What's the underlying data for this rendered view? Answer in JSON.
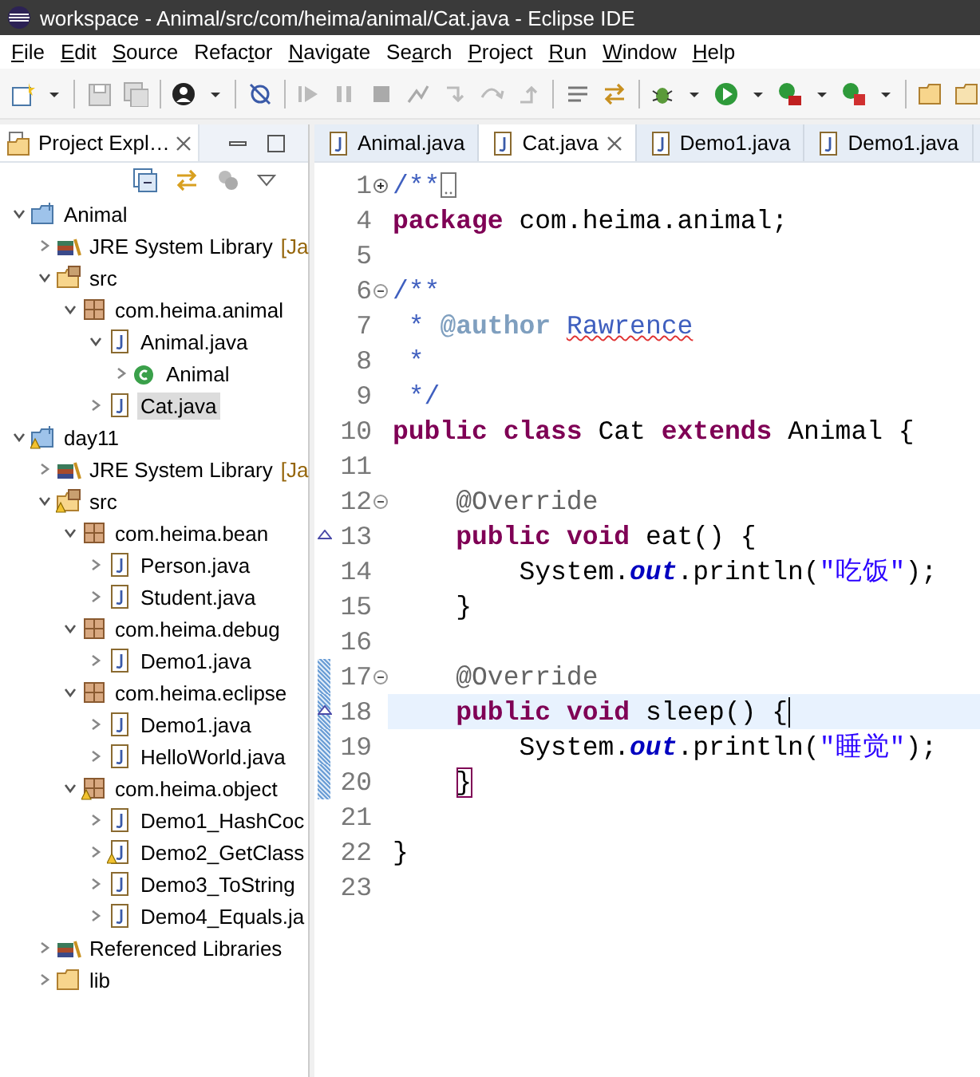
{
  "window": {
    "title": "workspace - Animal/src/com/heima/animal/Cat.java - Eclipse IDE"
  },
  "menu": [
    {
      "key": "F",
      "post": "ile"
    },
    {
      "key": "E",
      "post": "dit"
    },
    {
      "key": "S",
      "post": "ource"
    },
    {
      "pre": "Refac",
      "key": "t",
      "post": "or"
    },
    {
      "key": "N",
      "post": "avigate"
    },
    {
      "pre": "Se",
      "key": "a",
      "post": "rch"
    },
    {
      "key": "P",
      "post": "roject"
    },
    {
      "key": "R",
      "post": "un"
    },
    {
      "key": "W",
      "post": "indow"
    },
    {
      "key": "H",
      "post": "elp"
    }
  ],
  "explorer": {
    "title": "Project Expl…",
    "tree": [
      {
        "label": "Animal",
        "kind": "project",
        "expanded": true,
        "selected": false,
        "warning": false,
        "children": [
          {
            "label": "JRE System Library",
            "decoration": "[Ja",
            "kind": "library",
            "expanded": false,
            "selected": false,
            "warning": false
          },
          {
            "label": "src",
            "kind": "source-folder",
            "expanded": true,
            "selected": false,
            "warning": false,
            "children": [
              {
                "label": "com.heima.animal",
                "kind": "package",
                "expanded": true,
                "selected": false,
                "warning": false,
                "children": [
                  {
                    "label": "Animal.java",
                    "kind": "java-file",
                    "expanded": true,
                    "selected": false,
                    "warning": false,
                    "children": [
                      {
                        "label": "Animal",
                        "kind": "class",
                        "expanded": false,
                        "selected": false,
                        "warning": false
                      }
                    ]
                  },
                  {
                    "label": "Cat.java",
                    "kind": "java-file",
                    "expanded": false,
                    "selected": true,
                    "warning": false
                  }
                ]
              }
            ]
          }
        ]
      },
      {
        "label": "day11",
        "kind": "project",
        "expanded": true,
        "selected": false,
        "warning": true,
        "children": [
          {
            "label": "JRE System Library",
            "decoration": "[Ja",
            "kind": "library",
            "expanded": false,
            "selected": false,
            "warning": false
          },
          {
            "label": "src",
            "kind": "source-folder",
            "expanded": true,
            "selected": false,
            "warning": true,
            "children": [
              {
                "label": "com.heima.bean",
                "kind": "package",
                "expanded": true,
                "selected": false,
                "warning": false,
                "children": [
                  {
                    "label": "Person.java",
                    "kind": "java-file",
                    "expanded": false,
                    "selected": false,
                    "warning": false
                  },
                  {
                    "label": "Student.java",
                    "kind": "java-file",
                    "expanded": false,
                    "selected": false,
                    "warning": false
                  }
                ]
              },
              {
                "label": "com.heima.debug",
                "kind": "package",
                "expanded": true,
                "selected": false,
                "warning": false,
                "children": [
                  {
                    "label": "Demo1.java",
                    "kind": "java-file",
                    "expanded": false,
                    "selected": false,
                    "warning": false
                  }
                ]
              },
              {
                "label": "com.heima.eclipse",
                "kind": "package",
                "expanded": true,
                "selected": false,
                "warning": false,
                "children": [
                  {
                    "label": "Demo1.java",
                    "kind": "java-file",
                    "expanded": false,
                    "selected": false,
                    "warning": false
                  },
                  {
                    "label": "HelloWorld.java",
                    "kind": "java-file",
                    "expanded": false,
                    "selected": false,
                    "warning": false
                  }
                ]
              },
              {
                "label": "com.heima.object",
                "kind": "package",
                "expanded": true,
                "selected": false,
                "warning": true,
                "children": [
                  {
                    "label": "Demo1_HashCoc",
                    "kind": "java-file",
                    "expanded": false,
                    "selected": false,
                    "warning": false
                  },
                  {
                    "label": "Demo2_GetClass",
                    "kind": "java-file",
                    "expanded": false,
                    "selected": false,
                    "warning": true
                  },
                  {
                    "label": "Demo3_ToString",
                    "kind": "java-file",
                    "expanded": false,
                    "selected": false,
                    "warning": false
                  },
                  {
                    "label": "Demo4_Equals.ja",
                    "kind": "java-file",
                    "expanded": false,
                    "selected": false,
                    "warning": false
                  }
                ]
              }
            ]
          },
          {
            "label": "Referenced Libraries",
            "kind": "library",
            "expanded": false,
            "selected": false,
            "warning": false
          },
          {
            "label": "lib",
            "kind": "folder",
            "expanded": false,
            "selected": false,
            "warning": false
          }
        ]
      }
    ]
  },
  "tabs": [
    {
      "label": "Animal.java",
      "selected": false,
      "closable": false
    },
    {
      "label": "Cat.java",
      "selected": true,
      "closable": true
    },
    {
      "label": "Demo1.java",
      "selected": false,
      "closable": false
    },
    {
      "label": "Demo1.java",
      "selected": false,
      "closable": false
    }
  ],
  "editor": {
    "lines": [
      {
        "number": "1",
        "foldable": true,
        "folded": true,
        "override": false,
        "current": false,
        "caret": false,
        "changed": false,
        "tokens": [
          {
            "kind": "comment",
            "text": "/**"
          }
        ]
      },
      {
        "number": "4",
        "foldable": false,
        "folded": false,
        "override": false,
        "current": false,
        "caret": false,
        "changed": false,
        "tokens": [
          {
            "kind": "keyword",
            "text": "package"
          },
          {
            "kind": "plain",
            "text": " com.heima.animal;"
          }
        ]
      },
      {
        "number": "5",
        "foldable": false,
        "folded": false,
        "override": false,
        "current": false,
        "caret": false,
        "changed": false
      },
      {
        "number": "6",
        "foldable": true,
        "folded": false,
        "override": false,
        "current": false,
        "caret": false,
        "changed": false,
        "tokens": [
          {
            "kind": "comment",
            "text": "/**"
          }
        ]
      },
      {
        "number": "7",
        "foldable": false,
        "folded": false,
        "override": false,
        "current": false,
        "caret": false,
        "changed": false,
        "tokens": [
          {
            "kind": "comment",
            "text": " * "
          },
          {
            "kind": "javadoc-tag",
            "text": "@author"
          },
          {
            "kind": "misspelled",
            "text": " Rawrence"
          }
        ]
      },
      {
        "number": "8",
        "foldable": false,
        "folded": false,
        "override": false,
        "current": false,
        "caret": false,
        "changed": false,
        "tokens": [
          {
            "kind": "comment",
            "text": " *"
          }
        ]
      },
      {
        "number": "9",
        "foldable": false,
        "folded": false,
        "override": false,
        "current": false,
        "caret": false,
        "changed": false,
        "tokens": [
          {
            "kind": "comment",
            "text": " */"
          }
        ]
      },
      {
        "number": "10",
        "foldable": false,
        "folded": false,
        "override": false,
        "current": false,
        "caret": false,
        "changed": false,
        "tokens": [
          {
            "kind": "keyword",
            "text": "public"
          },
          {
            "kind": "keyword",
            "text": " class"
          },
          {
            "kind": "plain",
            "text": " Cat"
          },
          {
            "kind": "keyword",
            "text": " extends"
          },
          {
            "kind": "plain",
            "text": " Animal {"
          }
        ]
      },
      {
        "number": "11",
        "foldable": false,
        "folded": false,
        "override": false,
        "current": false,
        "caret": false,
        "changed": false
      },
      {
        "number": "12",
        "foldable": true,
        "folded": false,
        "override": false,
        "current": false,
        "caret": false,
        "changed": false,
        "tokens": [
          {
            "kind": "annotation",
            "text": "    @Override"
          }
        ]
      },
      {
        "number": "13",
        "foldable": false,
        "folded": false,
        "override": true,
        "current": false,
        "caret": false,
        "changed": false,
        "tokens": [
          {
            "kind": "keyword",
            "text": "    public"
          },
          {
            "kind": "keyword",
            "text": " void"
          },
          {
            "kind": "plain",
            "text": " eat() {"
          }
        ]
      },
      {
        "number": "14",
        "foldable": false,
        "folded": false,
        "override": false,
        "current": false,
        "caret": false,
        "changed": false,
        "tokens": [
          {
            "kind": "plain",
            "text": "        System."
          },
          {
            "kind": "static-field",
            "text": "out"
          },
          {
            "kind": "plain",
            "text": ".println("
          },
          {
            "kind": "string",
            "text": "\"吃饭\""
          },
          {
            "kind": "plain",
            "text": ");"
          }
        ]
      },
      {
        "number": "15",
        "foldable": false,
        "folded": false,
        "override": false,
        "current": false,
        "caret": false,
        "changed": false,
        "tokens": [
          {
            "kind": "plain",
            "text": "    }"
          }
        ]
      },
      {
        "number": "16",
        "foldable": false,
        "folded": false,
        "override": false,
        "current": false,
        "caret": false,
        "changed": false
      },
      {
        "number": "17",
        "foldable": true,
        "folded": false,
        "override": false,
        "current": false,
        "caret": false,
        "changed": true,
        "tokens": [
          {
            "kind": "annotation",
            "text": "    @Override"
          }
        ]
      },
      {
        "number": "18",
        "foldable": false,
        "folded": false,
        "override": true,
        "current": true,
        "caret": true,
        "changed": true,
        "tokens": [
          {
            "kind": "keyword",
            "text": "    public"
          },
          {
            "kind": "keyword",
            "text": " void"
          },
          {
            "kind": "plain",
            "text": " sleep() {"
          }
        ]
      },
      {
        "number": "19",
        "foldable": false,
        "folded": false,
        "override": false,
        "current": false,
        "caret": false,
        "changed": true,
        "tokens": [
          {
            "kind": "plain",
            "text": "        System."
          },
          {
            "kind": "static-field",
            "text": "out"
          },
          {
            "kind": "plain",
            "text": ".println("
          },
          {
            "kind": "string",
            "text": "\"睡觉\""
          },
          {
            "kind": "plain",
            "text": ");"
          }
        ]
      },
      {
        "number": "20",
        "foldable": false,
        "folded": false,
        "override": false,
        "current": false,
        "caret": false,
        "changed": true,
        "tokens": [
          {
            "kind": "matched-bracket",
            "text": "    }"
          }
        ]
      },
      {
        "number": "21",
        "foldable": false,
        "folded": false,
        "override": false,
        "current": false,
        "caret": false,
        "changed": false
      },
      {
        "number": "22",
        "foldable": false,
        "folded": false,
        "override": false,
        "current": false,
        "caret": false,
        "changed": false,
        "tokens": [
          {
            "kind": "plain",
            "text": "}"
          }
        ]
      },
      {
        "number": "23",
        "foldable": false,
        "folded": false,
        "override": false,
        "current": false,
        "caret": false,
        "changed": false
      }
    ]
  }
}
